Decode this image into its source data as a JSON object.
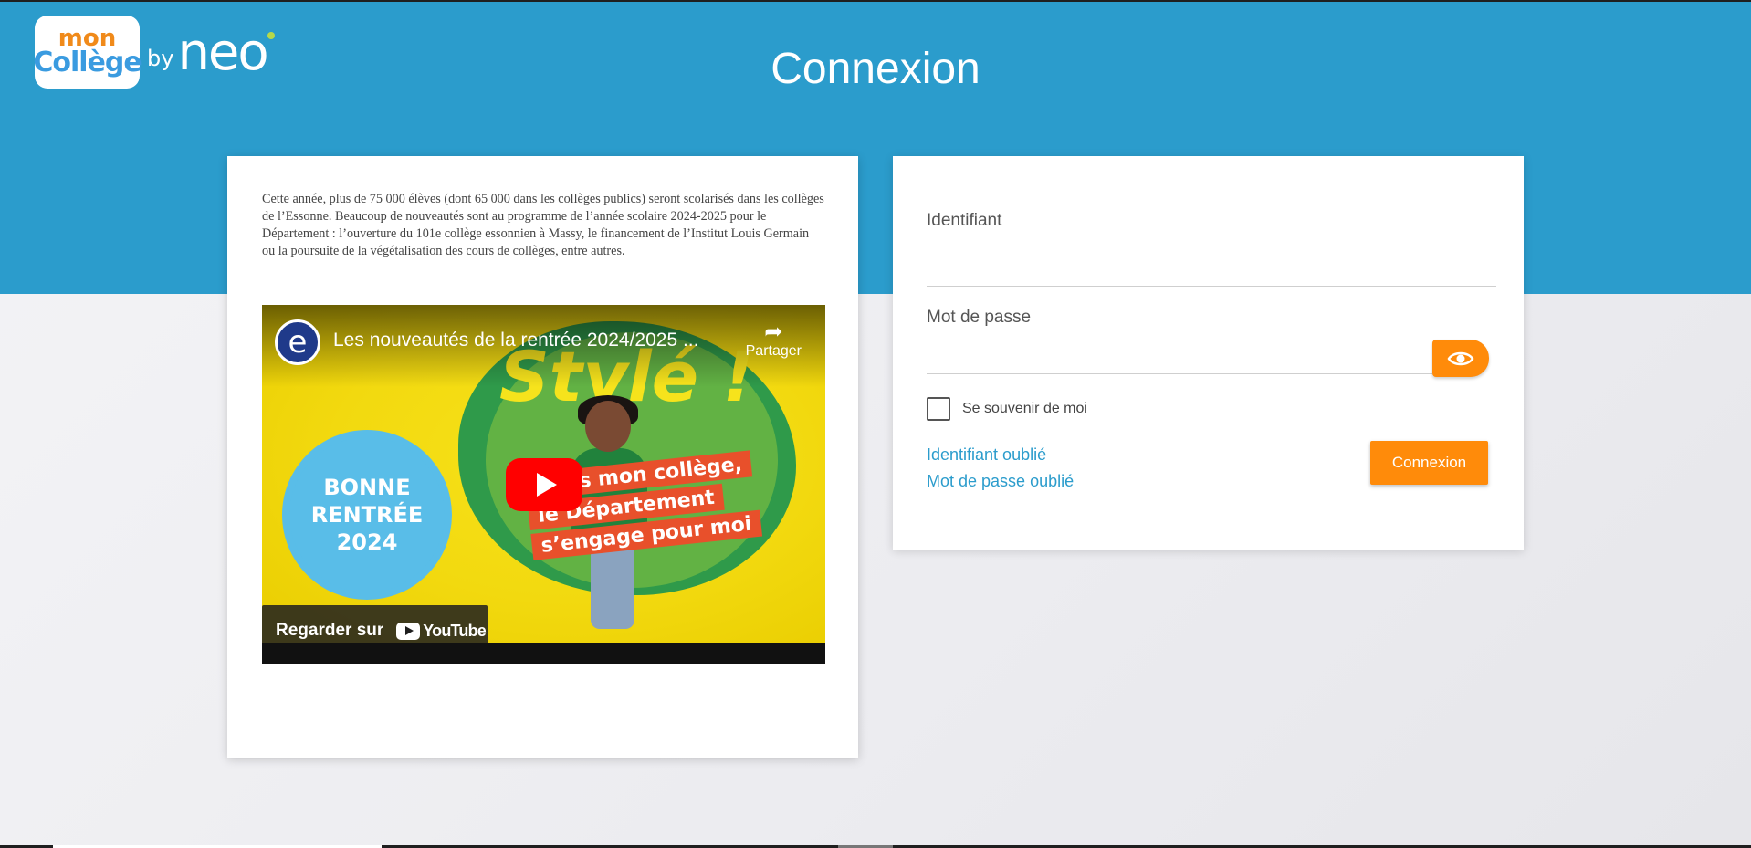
{
  "header": {
    "logo_line1": "mon",
    "logo_line2": "Collège",
    "logo_by": "by",
    "logo_neo": "neo",
    "title": "Connexion"
  },
  "colors": {
    "header_band": "#2b9ccc",
    "accent_orange": "#ff8b0a",
    "link_blue": "#2b9ccc"
  },
  "news": {
    "text": "Cette année, plus de 75 000 élèves (dont 65 000 dans les collèges publics) seront scolarisés dans les collèges de l’Essonne. Beaucoup de nouveautés sont au programme de l’année scolaire 2024-2025 pour le Département : l’ouverture du 101e collège essonnien à Massy, le financement de l’Institut Louis Germain ou la poursuite de la végétalisation des cours de collèges, entre autres."
  },
  "video": {
    "channel_initial": "e",
    "title": "Les nouveautés de la rentrée 2024/2025 ...",
    "share_label": "Partager",
    "headline": "Stylé !",
    "badge_line1": "BONNE",
    "badge_line2": "RENTRÉE",
    "badge_line3": "2024",
    "banner_line1": "Dans mon collège,",
    "banner_line2": "le Département",
    "banner_line3": "s’engage pour moi",
    "watch_label": "Regarder sur",
    "youtube_word": "YouTube"
  },
  "login": {
    "username_label": "Identifiant",
    "username_value": "",
    "password_label": "Mot de passe",
    "password_value": "",
    "show_password_icon": "eye-icon",
    "remember_label": "Se souvenir de moi",
    "remember_checked": false,
    "forgot_username": "Identifiant oublié",
    "forgot_password": "Mot de passe oublié",
    "submit_label": "Connexion"
  }
}
